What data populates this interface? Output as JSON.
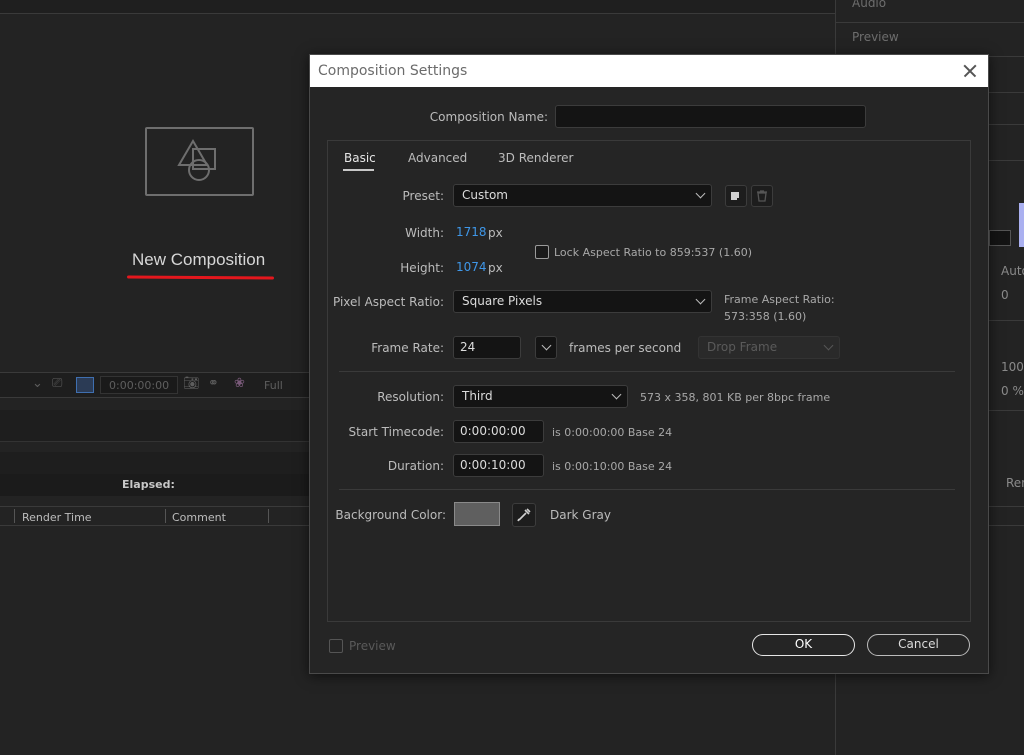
{
  "background": {
    "right_panel": {
      "items": [
        "Audio",
        "Preview"
      ],
      "values": [
        "Auto",
        "0",
        "100",
        "0 %",
        "Ren"
      ]
    },
    "viewer": {
      "placeholder_label": "New Composition",
      "timecode": "0:00:00:00",
      "resolution": "Full"
    },
    "render_queue": {
      "elapsed_label": "Elapsed:",
      "columns": [
        "Render Time",
        "Comment"
      ]
    }
  },
  "dialog": {
    "title": "Composition Settings",
    "composition_name_label": "Composition Name:",
    "composition_name_value": "",
    "tabs": [
      {
        "label": "Basic",
        "active": true
      },
      {
        "label": "Advanced",
        "active": false
      },
      {
        "label": "3D Renderer",
        "active": false
      }
    ],
    "preset": {
      "label": "Preset:",
      "value": "Custom"
    },
    "width": {
      "label": "Width:",
      "value": "1718",
      "unit": "px"
    },
    "height": {
      "label": "Height:",
      "value": "1074",
      "unit": "px"
    },
    "lock_aspect": {
      "label": "Lock Aspect Ratio to 859:537 (1.60)",
      "checked": false
    },
    "pixel_aspect": {
      "label": "Pixel Aspect Ratio:",
      "value": "Square Pixels"
    },
    "frame_aspect": {
      "label": "Frame Aspect Ratio:",
      "value": "573:358 (1.60)"
    },
    "frame_rate": {
      "label": "Frame Rate:",
      "value": "24",
      "unit": "frames per second",
      "drop_frame": "Drop Frame"
    },
    "resolution": {
      "label": "Resolution:",
      "value": "Third",
      "info": "573 x 358, 801 KB per 8bpc frame"
    },
    "start_timecode": {
      "label": "Start Timecode:",
      "value": "0:00:00:00",
      "info": "is 0:00:00:00  Base 24"
    },
    "duration": {
      "label": "Duration:",
      "value": "0:00:10:00",
      "info": "is 0:00:10:00  Base 24"
    },
    "background_color": {
      "label": "Background Color:",
      "name": "Dark Gray",
      "hex": "#5f5f5f"
    },
    "preview_label": "Preview",
    "ok_label": "OK",
    "cancel_label": "Cancel"
  },
  "colors": {
    "accent_blue": "#3f97e8",
    "annotation_red": "#e4171d",
    "dialog_bg": "#252525"
  }
}
